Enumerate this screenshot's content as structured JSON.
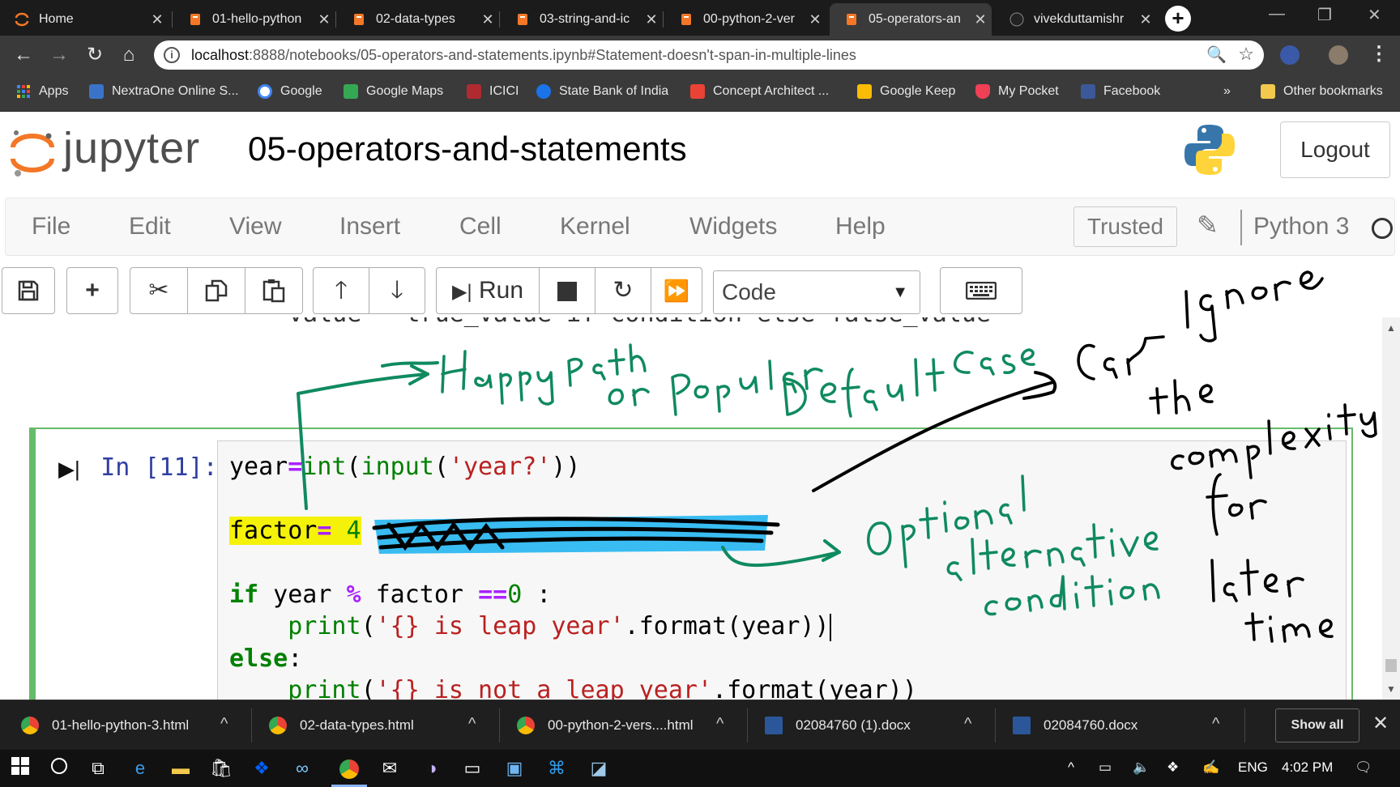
{
  "browser": {
    "tabs": [
      {
        "title": "Home",
        "active": false
      },
      {
        "title": "01-hello-python",
        "active": false
      },
      {
        "title": "02-data-types",
        "active": false
      },
      {
        "title": "03-string-and-ic",
        "active": false
      },
      {
        "title": "00-python-2-ver",
        "active": false
      },
      {
        "title": "05-operators-an",
        "active": true
      },
      {
        "title": "vivekduttamishr",
        "active": false
      }
    ],
    "url_host": "localhost",
    "url_rest": ":8888/notebooks/05-operators-and-statements.ipynb#Statement-doesn't-span-in-multiple-lines",
    "bookmarks": [
      "Apps",
      "NextraOne Online S...",
      "Google",
      "Google Maps",
      "ICICI",
      "State Bank of India",
      "Concept Architect ...",
      "Google Keep",
      "My Pocket",
      "Facebook"
    ],
    "bookmarks_more": "»",
    "other_bookmarks": "Other bookmarks"
  },
  "jupyter": {
    "logo_text": "jupyter",
    "notebook_title": "05-operators-and-statements",
    "logout_label": "Logout",
    "menu": [
      "File",
      "Edit",
      "View",
      "Insert",
      "Cell",
      "Kernel",
      "Widgets",
      "Help"
    ],
    "trusted_label": "Trusted",
    "kernel_name": "Python 3",
    "toolbar": {
      "run_label": "Run",
      "cell_type": "Code"
    }
  },
  "cell": {
    "prev_line": "value = true_value if condition else false_value",
    "prompt": "In [11]:",
    "lines": {
      "l1_a": "year",
      "l1_b": "=",
      "l1_c": "int",
      "l1_d": "(",
      "l1_e": "input",
      "l1_f": "(",
      "l1_g": "'year?'",
      "l1_h": "))",
      "l2_a": "factor",
      "l2_b": "=",
      "l2_c": " 4",
      "l3_a": "if",
      "l3_b": " year ",
      "l3_c": "%",
      "l3_d": " factor ",
      "l3_e": "==",
      "l3_f": "0",
      "l3_g": " :",
      "l4_a": "    ",
      "l4_b": "print",
      "l4_c": "(",
      "l4_d": "'{} is leap year'",
      "l4_e": ".format(year))",
      "l5_a": "else",
      "l5_b": ":",
      "l6_a": "    ",
      "l6_b": "print",
      "l6_c": "(",
      "l6_d": "'{} is not a leap year'",
      "l6_e": ".format(year))"
    }
  },
  "downloads": [
    {
      "name": "01-hello-python-3.html"
    },
    {
      "name": "02-data-types.html"
    },
    {
      "name": "00-python-2-vers....html"
    },
    {
      "name": "02084760 (1).docx"
    },
    {
      "name": "02084760.docx"
    }
  ],
  "show_all_label": "Show all",
  "taskbar": {
    "lang": "ENG",
    "time": "4:02 PM"
  },
  "colors": {
    "ink_green": "#0f8a5f",
    "ink_black": "#000000",
    "highlight_yellow": "#f5f20a",
    "highlight_blue": "#2eb8f0",
    "cell_border": "#66bb6a"
  }
}
